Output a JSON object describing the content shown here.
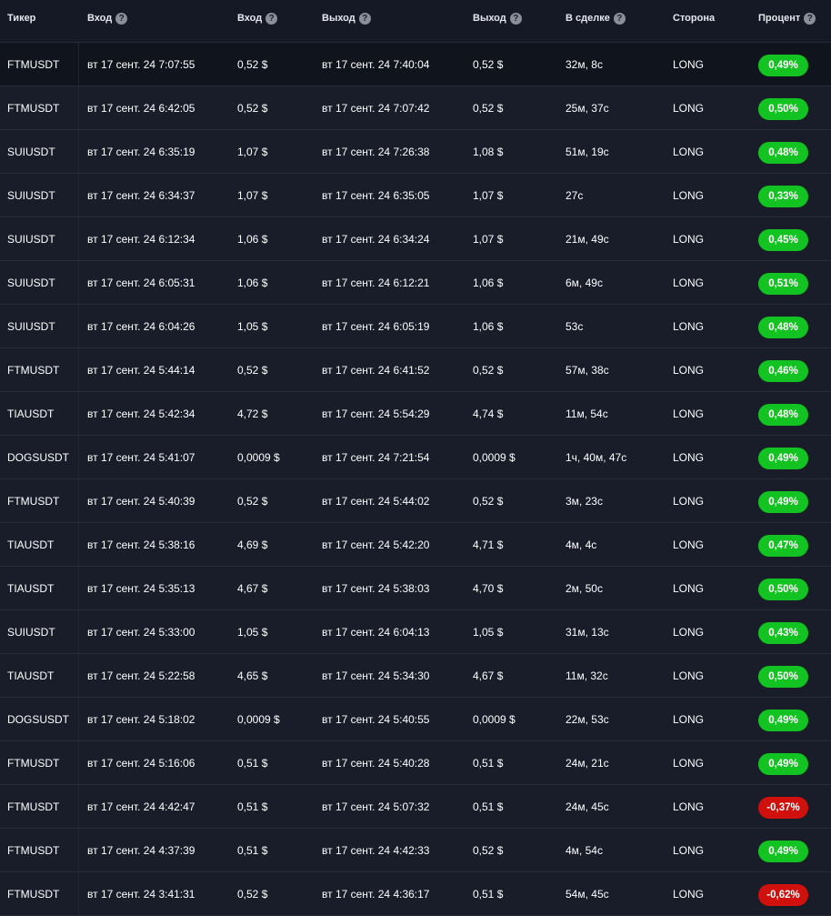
{
  "colors": {
    "positive": "#13c322",
    "negative": "#d0100c",
    "background": "#181d29"
  },
  "header": {
    "ticker": "Тикер",
    "entry_time": "Вход",
    "entry_price": "Вход",
    "exit_time": "Выход",
    "exit_price": "Выход",
    "in_trade": "В сделке",
    "side": "Сторона",
    "percent": "Процент",
    "help_icon_glyph": "?"
  },
  "rows": [
    {
      "ticker": "FTMUSDT",
      "entry_time": "вт 17 сент. 24 7:07:55",
      "entry_price": "0,52 $",
      "exit_time": "вт 17 сент. 24 7:40:04",
      "exit_price": "0,52 $",
      "duration": "32м, 8с",
      "side": "LONG",
      "percent": "0,49%",
      "sign": "pos"
    },
    {
      "ticker": "FTMUSDT",
      "entry_time": "вт 17 сент. 24 6:42:05",
      "entry_price": "0,52 $",
      "exit_time": "вт 17 сент. 24 7:07:42",
      "exit_price": "0,52 $",
      "duration": "25м, 37с",
      "side": "LONG",
      "percent": "0,50%",
      "sign": "pos"
    },
    {
      "ticker": "SUIUSDT",
      "entry_time": "вт 17 сент. 24 6:35:19",
      "entry_price": "1,07 $",
      "exit_time": "вт 17 сент. 24 7:26:38",
      "exit_price": "1,08 $",
      "duration": "51м, 19с",
      "side": "LONG",
      "percent": "0,48%",
      "sign": "pos"
    },
    {
      "ticker": "SUIUSDT",
      "entry_time": "вт 17 сент. 24 6:34:37",
      "entry_price": "1,07 $",
      "exit_time": "вт 17 сент. 24 6:35:05",
      "exit_price": "1,07 $",
      "duration": "27с",
      "side": "LONG",
      "percent": "0,33%",
      "sign": "pos"
    },
    {
      "ticker": "SUIUSDT",
      "entry_time": "вт 17 сент. 24 6:12:34",
      "entry_price": "1,06 $",
      "exit_time": "вт 17 сент. 24 6:34:24",
      "exit_price": "1,07 $",
      "duration": "21м, 49с",
      "side": "LONG",
      "percent": "0,45%",
      "sign": "pos"
    },
    {
      "ticker": "SUIUSDT",
      "entry_time": "вт 17 сент. 24 6:05:31",
      "entry_price": "1,06 $",
      "exit_time": "вт 17 сент. 24 6:12:21",
      "exit_price": "1,06 $",
      "duration": "6м, 49с",
      "side": "LONG",
      "percent": "0,51%",
      "sign": "pos"
    },
    {
      "ticker": "SUIUSDT",
      "entry_time": "вт 17 сент. 24 6:04:26",
      "entry_price": "1,05 $",
      "exit_time": "вт 17 сент. 24 6:05:19",
      "exit_price": "1,06 $",
      "duration": "53с",
      "side": "LONG",
      "percent": "0,48%",
      "sign": "pos"
    },
    {
      "ticker": "FTMUSDT",
      "entry_time": "вт 17 сент. 24 5:44:14",
      "entry_price": "0,52 $",
      "exit_time": "вт 17 сент. 24 6:41:52",
      "exit_price": "0,52 $",
      "duration": "57м, 38с",
      "side": "LONG",
      "percent": "0,46%",
      "sign": "pos"
    },
    {
      "ticker": "TIAUSDT",
      "entry_time": "вт 17 сент. 24 5:42:34",
      "entry_price": "4,72 $",
      "exit_time": "вт 17 сент. 24 5:54:29",
      "exit_price": "4,74 $",
      "duration": "11м, 54с",
      "side": "LONG",
      "percent": "0,48%",
      "sign": "pos"
    },
    {
      "ticker": "DOGSUSDT",
      "entry_time": "вт 17 сент. 24 5:41:07",
      "entry_price": "0,0009 $",
      "exit_time": "вт 17 сент. 24 7:21:54",
      "exit_price": "0,0009 $",
      "duration": "1ч, 40м, 47с",
      "side": "LONG",
      "percent": "0,49%",
      "sign": "pos"
    },
    {
      "ticker": "FTMUSDT",
      "entry_time": "вт 17 сент. 24 5:40:39",
      "entry_price": "0,52 $",
      "exit_time": "вт 17 сент. 24 5:44:02",
      "exit_price": "0,52 $",
      "duration": "3м, 23с",
      "side": "LONG",
      "percent": "0,49%",
      "sign": "pos"
    },
    {
      "ticker": "TIAUSDT",
      "entry_time": "вт 17 сент. 24 5:38:16",
      "entry_price": "4,69 $",
      "exit_time": "вт 17 сент. 24 5:42:20",
      "exit_price": "4,71 $",
      "duration": "4м, 4с",
      "side": "LONG",
      "percent": "0,47%",
      "sign": "pos"
    },
    {
      "ticker": "TIAUSDT",
      "entry_time": "вт 17 сент. 24 5:35:13",
      "entry_price": "4,67 $",
      "exit_time": "вт 17 сент. 24 5:38:03",
      "exit_price": "4,70 $",
      "duration": "2м, 50с",
      "side": "LONG",
      "percent": "0,50%",
      "sign": "pos"
    },
    {
      "ticker": "SUIUSDT",
      "entry_time": "вт 17 сент. 24 5:33:00",
      "entry_price": "1,05 $",
      "exit_time": "вт 17 сент. 24 6:04:13",
      "exit_price": "1,05 $",
      "duration": "31м, 13с",
      "side": "LONG",
      "percent": "0,43%",
      "sign": "pos"
    },
    {
      "ticker": "TIAUSDT",
      "entry_time": "вт 17 сент. 24 5:22:58",
      "entry_price": "4,65 $",
      "exit_time": "вт 17 сент. 24 5:34:30",
      "exit_price": "4,67 $",
      "duration": "11м, 32с",
      "side": "LONG",
      "percent": "0,50%",
      "sign": "pos"
    },
    {
      "ticker": "DOGSUSDT",
      "entry_time": "вт 17 сент. 24 5:18:02",
      "entry_price": "0,0009 $",
      "exit_time": "вт 17 сент. 24 5:40:55",
      "exit_price": "0,0009 $",
      "duration": "22м, 53с",
      "side": "LONG",
      "percent": "0,49%",
      "sign": "pos"
    },
    {
      "ticker": "FTMUSDT",
      "entry_time": "вт 17 сент. 24 5:16:06",
      "entry_price": "0,51 $",
      "exit_time": "вт 17 сент. 24 5:40:28",
      "exit_price": "0,51 $",
      "duration": "24м, 21с",
      "side": "LONG",
      "percent": "0,49%",
      "sign": "pos"
    },
    {
      "ticker": "FTMUSDT",
      "entry_time": "вт 17 сент. 24 4:42:47",
      "entry_price": "0,51 $",
      "exit_time": "вт 17 сент. 24 5:07:32",
      "exit_price": "0,51 $",
      "duration": "24м, 45с",
      "side": "LONG",
      "percent": "-0,37%",
      "sign": "neg"
    },
    {
      "ticker": "FTMUSDT",
      "entry_time": "вт 17 сент. 24 4:37:39",
      "entry_price": "0,51 $",
      "exit_time": "вт 17 сент. 24 4:42:33",
      "exit_price": "0,52 $",
      "duration": "4м, 54с",
      "side": "LONG",
      "percent": "0,49%",
      "sign": "pos"
    },
    {
      "ticker": "FTMUSDT",
      "entry_time": "вт 17 сент. 24 3:41:31",
      "entry_price": "0,52 $",
      "exit_time": "вт 17 сент. 24 4:36:17",
      "exit_price": "0,51 $",
      "duration": "54м, 45с",
      "side": "LONG",
      "percent": "-0,62%",
      "sign": "neg"
    }
  ]
}
